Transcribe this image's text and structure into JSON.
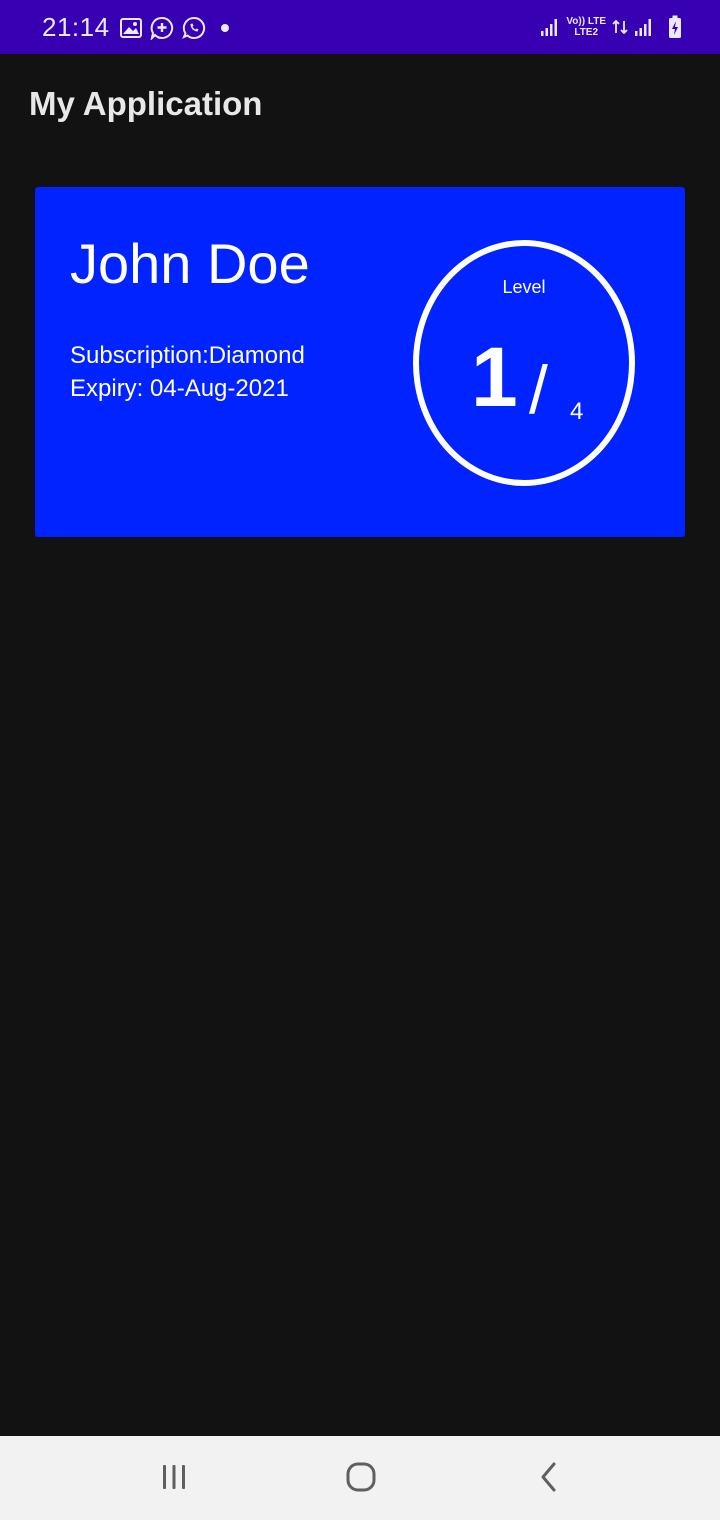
{
  "status_bar": {
    "time": "21:14",
    "network_label_top": "Vo)) LTE",
    "network_label_bottom": "LTE2",
    "left_icons": [
      "gallery-icon",
      "chat-plus-icon",
      "whatsapp-icon",
      "dot-icon"
    ],
    "right_icons": [
      "signal-icon",
      "volte-icon",
      "lte-data-icon",
      "signal-icon",
      "battery-charging-icon"
    ],
    "background_color": "#3700b3"
  },
  "app_bar": {
    "title": "My Application"
  },
  "card": {
    "name": "John Doe",
    "subscription": "Subscription:Diamond",
    "expiry": "Expiry: 04-Aug-2021",
    "background_color": "#0023ff",
    "level": {
      "label": "Level",
      "current": "1",
      "separator": "/",
      "max": "4"
    }
  },
  "nav_bar": {
    "buttons": [
      "recents-icon",
      "home-icon",
      "back-icon"
    ]
  }
}
